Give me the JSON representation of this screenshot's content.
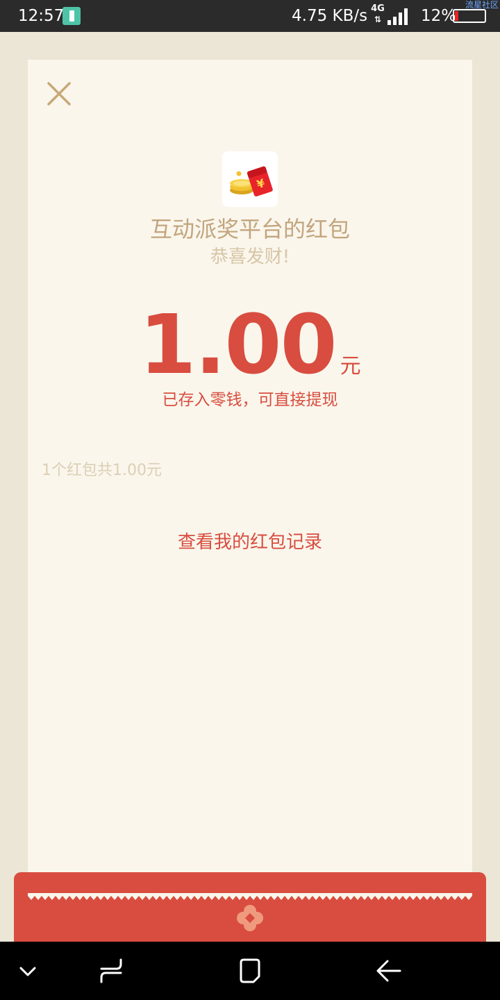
{
  "status_bar": {
    "time": "12:57",
    "network_speed": "4.75 KB/s",
    "network_type": "4G",
    "network_arrows": "⇅",
    "battery_percent": "12%",
    "battery_level": 0.12,
    "watermark": "流星社区",
    "charging_icon": "battery-charging-icon",
    "signal_icon": "signal-bars-icon",
    "battery_icon": "battery-icon"
  },
  "card": {
    "close_icon": "close-icon",
    "logo_icon": "red-envelope-coins-icon",
    "sender_name": "互动派奖平台的红包",
    "greeting": "恭喜发财!",
    "amount": "1.00",
    "currency_unit": "元",
    "stored_note": "已存入零钱，可直接提现",
    "packet_summary": "1个红包共1.00元",
    "records_link": "查看我的红包记录"
  },
  "envelope": {
    "flower_icon": "flower-icon"
  },
  "nav_bar": {
    "items": [
      "chevron-down-icon",
      "recent-apps-icon",
      "home-icon",
      "back-icon"
    ]
  },
  "colors": {
    "accent_red": "#d84d3f",
    "gold_text": "#c2a57e",
    "muted_gold": "#d7c6a6",
    "card_bg": "#faf6ec",
    "page_bg": "#ece6d6",
    "status_bar_bg": "#2b2b2b",
    "nav_bar_bg": "#000000"
  }
}
